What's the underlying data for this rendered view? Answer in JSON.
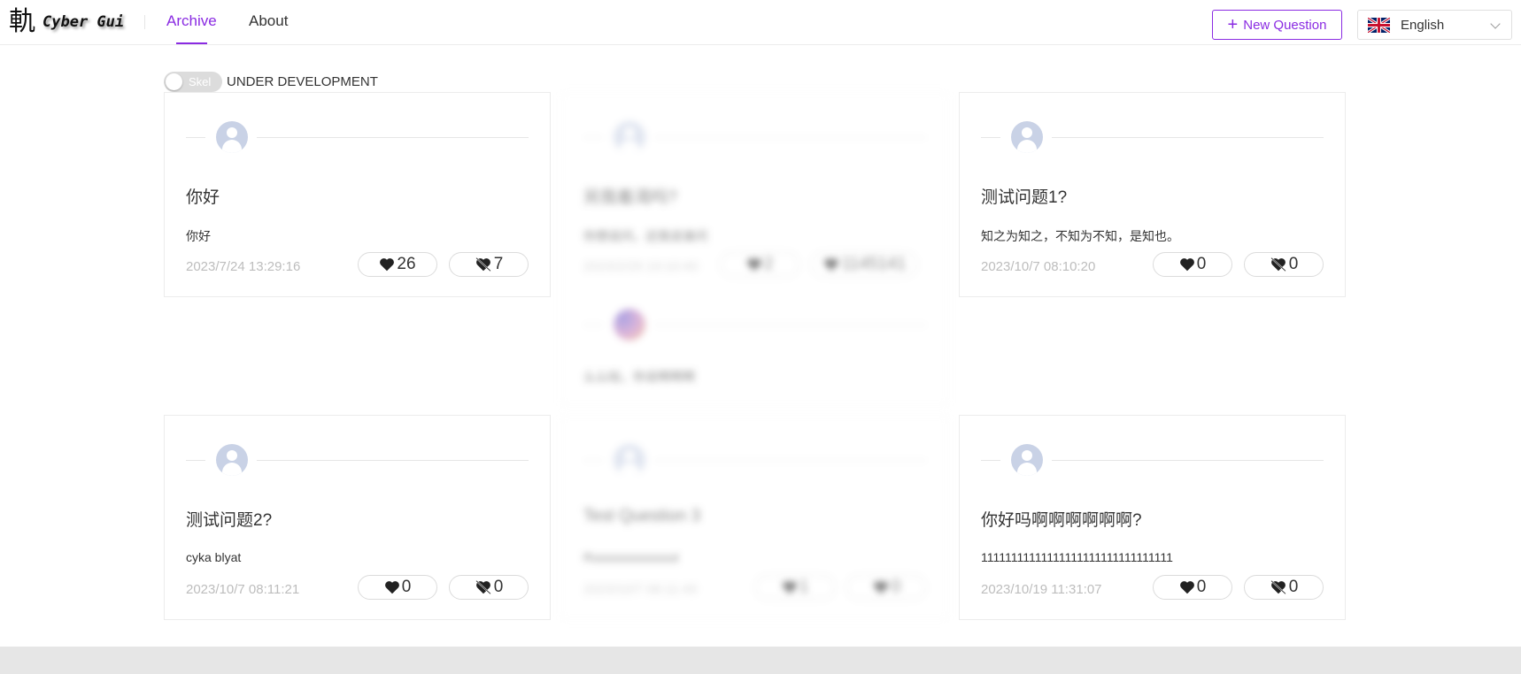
{
  "header": {
    "logo_glyph": "軌",
    "logo_text": "Cyber Gui",
    "nav": [
      {
        "label": "Archive",
        "active": true
      },
      {
        "label": "About",
        "active": false
      }
    ],
    "new_question_label": "New Question",
    "new_question_icon": "plus-icon",
    "language": {
      "label": "English",
      "flag": "uk-flag-icon"
    },
    "accent_color": "#8a2be2"
  },
  "toggle": {
    "label": "Skel",
    "checked": false,
    "description": "UNDER DEVELOPMENT"
  },
  "cards": [
    {
      "title": "你好",
      "body": "你好",
      "date": "2023/7/24 13:29:16",
      "likes": "26",
      "dislikes": "7"
    },
    {
      "title": "另我着渴吗?",
      "body": "你想说问，还我说谁问",
      "date": "2023/2/29 19:10:40",
      "likes": "2",
      "dislikes": "1145141",
      "blurred": true,
      "comment": "么么哒，你说啊啊啊"
    },
    {
      "title": "测试问题1?",
      "body": "知之为知之，不知为不知，是知也。",
      "date": "2023/10/7 08:10:20",
      "likes": "0",
      "dislikes": "0"
    },
    {
      "title": "测试问题2?",
      "body": "cyka blyat",
      "date": "2023/10/7 08:11:21",
      "likes": "0",
      "dislikes": "0"
    },
    {
      "title": "Test Question 3",
      "body": "Ruuuuuuuuuuuut",
      "date": "2023/10/7 08:11:49",
      "likes": "1",
      "dislikes": "0",
      "blurred": true
    },
    {
      "title": "你好吗啊啊啊啊啊啊?",
      "body": "11111111111111111111111111111111",
      "date": "2023/10/19 11:31:07",
      "likes": "0",
      "dislikes": "0"
    }
  ]
}
